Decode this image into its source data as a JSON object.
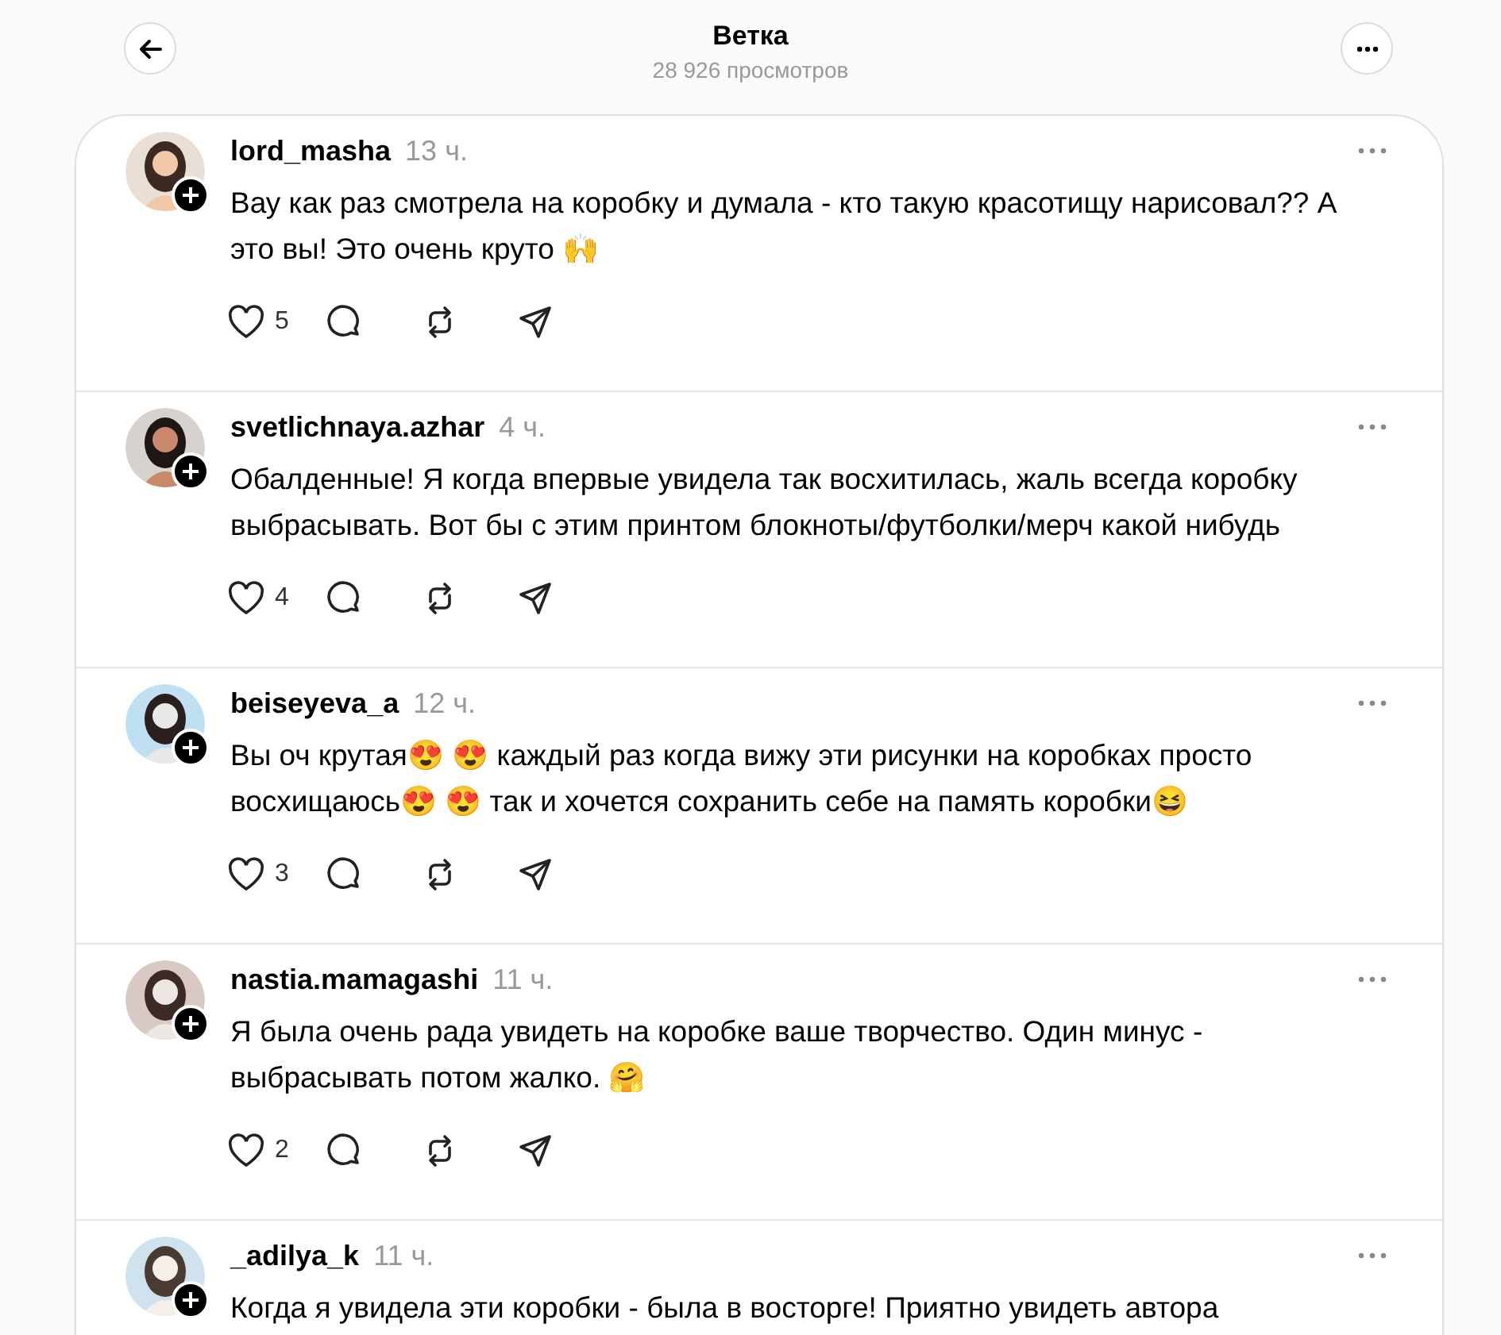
{
  "header": {
    "title": "Ветка",
    "views": "28 926 просмотров"
  },
  "posts": [
    {
      "username": "lord_masha",
      "time": "13 ч.",
      "text": "Вау как раз смотрела на коробку и думала - кто такую красотищу нарисовал?? А это вы! Это очень круто 🙌",
      "likes": "5"
    },
    {
      "username": "svetlichnaya.azhar",
      "time": "4 ч.",
      "text": "Обалденные! Я когда впервые увидела так восхитилась, жаль всегда коробку выбрасывать. Вот бы с этим принтом блокноты/футболки/мерч какой нибудь",
      "likes": "4"
    },
    {
      "username": "beiseyeva_a",
      "time": "12 ч.",
      "text": "Вы оч крутая😍 😍  каждый раз когда вижу эти рисунки на коробках просто восхищаюсь😍 😍  так и хочется сохранить себе на память коробки😆",
      "likes": "3"
    },
    {
      "username": "nastia.mamagashi",
      "time": "11 ч.",
      "text": "Я была очень рада увидеть на коробке ваше творчество. Один минус - выбрасывать потом жалко. 🤗",
      "likes": "2"
    },
    {
      "username": "_adilya_k",
      "time": "11 ч.",
      "text": "Когда я увидела эти коробки - была в восторге! Приятно увидеть автора"
    }
  ]
}
